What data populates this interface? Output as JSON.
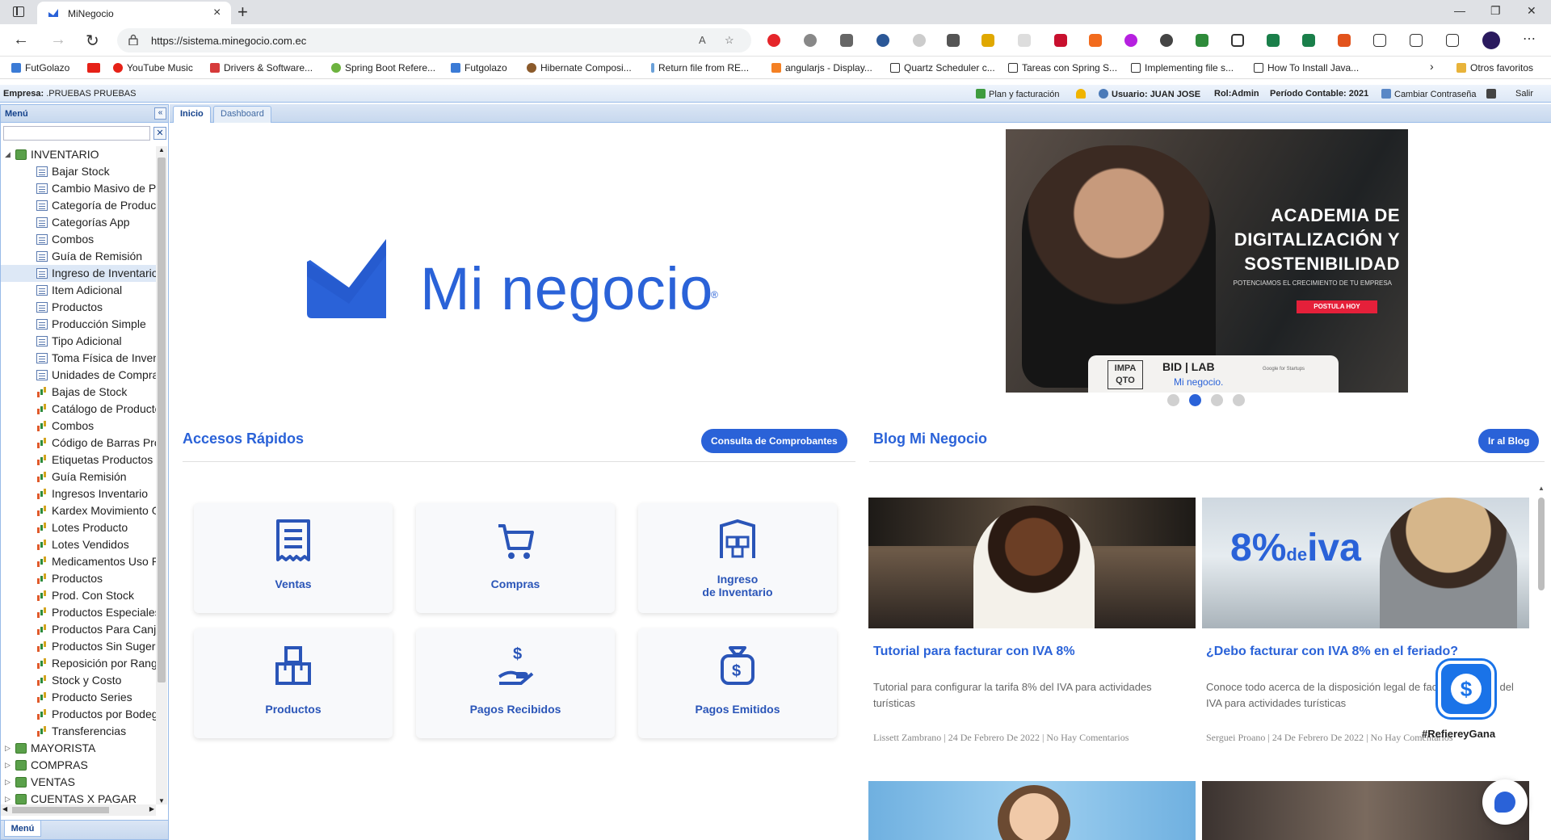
{
  "browser": {
    "tab_title": "MiNegocio",
    "new_tab": "+",
    "url": "https://sistema.minegocio.com.ec",
    "bookmarks": [
      {
        "label": "FutGolazo",
        "color": "#3b7bd6"
      },
      {
        "label": "",
        "color": "#e62117"
      },
      {
        "label": "YouTube Music",
        "color": "#e62117"
      },
      {
        "label": "Drivers & Software...",
        "color": "#d63a3a"
      },
      {
        "label": "Spring Boot Refere...",
        "color": "#6db33f"
      },
      {
        "label": "Futgolazo",
        "color": "#3b7bd6"
      },
      {
        "label": "Hibernate Composi...",
        "color": "#8b5a2b"
      },
      {
        "label": "Return file from RE...",
        "color": "#6aa0d8"
      },
      {
        "label": "angularjs - Display...",
        "color": "#f48024"
      },
      {
        "label": "Quartz Scheduler c...",
        "color": "#888888"
      },
      {
        "label": "Tareas con Spring S...",
        "color": "#888888"
      },
      {
        "label": "Implementing file s...",
        "color": "#888888"
      },
      {
        "label": "How To Install Java...",
        "color": "#888888"
      }
    ],
    "other_favorites": "Otros favoritos"
  },
  "header": {
    "empresa_label": "Empresa:",
    "empresa_value": ".PRUEBAS   PRUEBAS",
    "plan": "Plan y facturación",
    "usuario_label": "Usuario:",
    "usuario_value": "JUAN JOSE",
    "rol_label": "Rol:",
    "rol_value": "Admin",
    "periodo_label": "Período Contable:",
    "periodo_value": "2021",
    "change_password": "Cambiar Contraseña",
    "logout": "Salir"
  },
  "sidebar": {
    "title": "Menú",
    "footer_tab": "Menú",
    "collapse_glyph": "«",
    "clear_glyph": "✕",
    "search_value": "",
    "tree": [
      {
        "label": "INVENTARIO",
        "level": 0,
        "icon": "folder-icon",
        "expanded": true
      },
      {
        "label": "Bajar Stock",
        "level": 1,
        "icon": "doc-icon"
      },
      {
        "label": "Cambio Masivo de Pr",
        "level": 1,
        "icon": "doc-icon"
      },
      {
        "label": "Categoría de Producto",
        "level": 1,
        "icon": "doc-icon"
      },
      {
        "label": "Categorías App",
        "level": 1,
        "icon": "doc-icon"
      },
      {
        "label": "Combos",
        "level": 1,
        "icon": "doc-icon"
      },
      {
        "label": "Guía de Remisión",
        "level": 1,
        "icon": "doc-icon"
      },
      {
        "label": "Ingreso de Inventario",
        "level": 1,
        "icon": "doc-icon",
        "selected": true
      },
      {
        "label": "Item Adicional",
        "level": 1,
        "icon": "doc-icon"
      },
      {
        "label": "Productos",
        "level": 1,
        "icon": "doc-icon"
      },
      {
        "label": "Producción Simple",
        "level": 1,
        "icon": "doc-icon"
      },
      {
        "label": "Tipo Adicional",
        "level": 1,
        "icon": "doc-icon"
      },
      {
        "label": "Toma Física de Invent",
        "level": 1,
        "icon": "doc-icon"
      },
      {
        "label": "Unidades de Compra/",
        "level": 1,
        "icon": "doc-icon"
      },
      {
        "label": "Bajas de Stock",
        "level": 1,
        "icon": "chart-icon"
      },
      {
        "label": "Catálogo de Producto",
        "level": 1,
        "icon": "chart-icon"
      },
      {
        "label": "Combos",
        "level": 1,
        "icon": "chart-icon"
      },
      {
        "label": "Código de Barras Pro",
        "level": 1,
        "icon": "chart-icon"
      },
      {
        "label": "Etiquetas Productos",
        "level": 1,
        "icon": "chart-icon"
      },
      {
        "label": "Guía Remisión",
        "level": 1,
        "icon": "chart-icon"
      },
      {
        "label": "Ingresos Inventario",
        "level": 1,
        "icon": "chart-icon"
      },
      {
        "label": "Kardex Movimiento Gi",
        "level": 1,
        "icon": "chart-icon"
      },
      {
        "label": "Lotes Producto",
        "level": 1,
        "icon": "chart-icon"
      },
      {
        "label": "Lotes Vendidos",
        "level": 1,
        "icon": "chart-icon"
      },
      {
        "label": "Medicamentos Uso Re",
        "level": 1,
        "icon": "chart-icon"
      },
      {
        "label": "Productos",
        "level": 1,
        "icon": "chart-icon"
      },
      {
        "label": "Prod. Con Stock",
        "level": 1,
        "icon": "chart-icon"
      },
      {
        "label": "Productos Especiales",
        "level": 1,
        "icon": "chart-icon"
      },
      {
        "label": "Productos Para Canje",
        "level": 1,
        "icon": "chart-icon"
      },
      {
        "label": "Productos Sin Sugeric",
        "level": 1,
        "icon": "chart-icon"
      },
      {
        "label": "Reposición por Rango",
        "level": 1,
        "icon": "chart-icon"
      },
      {
        "label": "Stock y Costo",
        "level": 1,
        "icon": "chart-icon"
      },
      {
        "label": "Producto Series",
        "level": 1,
        "icon": "chart-icon"
      },
      {
        "label": "Productos por Bodega",
        "level": 1,
        "icon": "chart-icon"
      },
      {
        "label": "Transferencias",
        "level": 1,
        "icon": "chart-icon"
      },
      {
        "label": "MAYORISTA",
        "level": 0,
        "icon": "folder-icon"
      },
      {
        "label": "COMPRAS",
        "level": 0,
        "icon": "folder-icon"
      },
      {
        "label": "VENTAS",
        "level": 0,
        "icon": "folder-icon"
      },
      {
        "label": "CUENTAS X PAGAR",
        "level": 0,
        "icon": "folder-icon"
      }
    ]
  },
  "tabs": [
    {
      "label": "Inicio",
      "active": true
    },
    {
      "label": "Dashboard",
      "active": false
    }
  ],
  "main": {
    "logo_text": "Mi negocio",
    "logo_reg": "®",
    "banner": {
      "title_line1": "ACADEMIA DE",
      "title_line2": "DIGITALIZACIÓN Y",
      "title_line3": "SOSTENIBILIDAD",
      "subtitle": "POTENCIAMOS EL CRECIMIENTO DE TU EMPRESA",
      "cta": "POSTULA HOY",
      "logo_impaqto": "IMPA QTO",
      "logo_bid": "BID | LAB",
      "logo_mn": "Mi negocio.",
      "logo_google": "Google for Startups",
      "active_slide": 2,
      "slide_count": 4
    },
    "quick_access_title": "Accesos Rápidos",
    "quick_access_button": "Consulta de Comprobantes",
    "quick_access": [
      {
        "label": "Ventas",
        "icon": "receipt-icon"
      },
      {
        "label": "Compras",
        "icon": "cart-icon"
      },
      {
        "label": "Ingreso\nde Inventario",
        "icon": "warehouse-icon"
      },
      {
        "label": "Productos",
        "icon": "boxes-icon"
      },
      {
        "label": "Pagos Recibidos",
        "icon": "hand-money-icon"
      },
      {
        "label": "Pagos Emitidos",
        "icon": "money-bag-icon"
      }
    ],
    "blog_title": "Blog Mi Negocio",
    "blog_button": "Ir al Blog",
    "posts": [
      {
        "title": "Tutorial para facturar con IVA 8%",
        "desc": "Tutorial para configurar la tarifa 8% del IVA para actividades turísticas",
        "meta": "Lissett Zambrano  |  24 De Febrero De 2022  |  No Hay Comentarios"
      },
      {
        "title": "¿Debo facturar con IVA 8% en el feriado?",
        "desc": "Conoce todo acerca de la disposición legal de facturar con 8% del IVA para actividades turísticas",
        "meta": "Serguei Proano  |  24 De Febrero De 2022  |  No Hay Comentarios",
        "image_text_big": "8%",
        "image_text_small": "de",
        "image_text_word": "iva"
      }
    ],
    "promo_glyph": "$",
    "promo_text": "#RefiereyGana"
  }
}
